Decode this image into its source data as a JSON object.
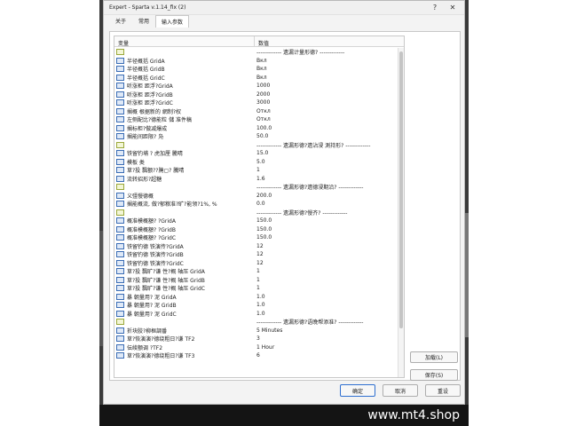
{
  "window": {
    "title": "Expert - Sparta v.1.14_fix (2)",
    "help_glyph": "?",
    "close_glyph": "✕"
  },
  "tabs": [
    {
      "label": "关于",
      "active": false
    },
    {
      "label": "常用",
      "active": false
    },
    {
      "label": "输入参数",
      "active": true
    }
  ],
  "table": {
    "col_variable": "变量",
    "col_value": "数值",
    "rows": [
      {
        "icon": "sep",
        "name": "",
        "value": "------------- 遗漏计量形德? -------------"
      },
      {
        "icon": "abc",
        "name": "半径概括    GridA",
        "value": "Вкл"
      },
      {
        "icon": "abc",
        "name": "半径概括    GridB",
        "value": "Вкл"
      },
      {
        "icon": "abc",
        "name": "半径概括    GridC",
        "value": "Вкл"
      },
      {
        "icon": "123",
        "name": "听涨柜 距浮?GridA",
        "value": "1000"
      },
      {
        "icon": "123",
        "name": "听涨柜 距浮?GridB",
        "value": "2000"
      },
      {
        "icon": "123",
        "name": "听涨柜 距浮?GridC",
        "value": "3000"
      },
      {
        "icon": "abc",
        "name": "搁概 根据新的 網制?权",
        "value": "Откл"
      },
      {
        "icon": "abc",
        "name": "左侧配比?德能粒 儲 准件稿",
        "value": "Откл"
      },
      {
        "icon": "123",
        "name": "搁标柜?做减爆成",
        "value": "100.0"
      },
      {
        "icon": "123",
        "name": "搁能间距限? 凫",
        "value": "50.0"
      },
      {
        "icon": "sep",
        "name": "",
        "value": "------------- 遗漏形德?遗沾浸 測持形? -------------"
      },
      {
        "icon": "123",
        "name": "铁留钓埔  ? 虎加厘 騰晴",
        "value": "15.0"
      },
      {
        "icon": "123",
        "name": "模板 类",
        "value": "5.0"
      },
      {
        "icon": "123",
        "name": "草?投 飄额??腌▢? 騰晴",
        "value": "1"
      },
      {
        "icon": "123",
        "name": "流转招形?超糖",
        "value": "1.6"
      },
      {
        "icon": "sep",
        "name": "",
        "value": "------------- 遗漏形德?遗德浸期沿? -------------"
      },
      {
        "icon": "123",
        "name": "义彊慢德概",
        "value": "200.0"
      },
      {
        "icon": "123",
        "name": "搁能概流, 做?郁粮准?旷?能领?1%, %",
        "value": "0.0"
      },
      {
        "icon": "sep",
        "name": "",
        "value": "------------- 遗漏形德?慢齐? -------------"
      },
      {
        "icon": "123",
        "name": "概准模概額?   ?GridA",
        "value": "150.0"
      },
      {
        "icon": "123",
        "name": "概准模概額?   ?GridB",
        "value": "150.0"
      },
      {
        "icon": "123",
        "name": "概准模概額?   ?GridC",
        "value": "150.0"
      },
      {
        "icon": "123",
        "name": "铁留钓德 铁演传?GridA",
        "value": "12"
      },
      {
        "icon": "123",
        "name": "铁留钓德 铁演传?GridB",
        "value": "12"
      },
      {
        "icon": "123",
        "name": "铁留钓德 铁演传?GridC",
        "value": "12"
      },
      {
        "icon": "123",
        "name": "草?投 飄旷?谦   性?概    轴压 GridA",
        "value": "1"
      },
      {
        "icon": "123",
        "name": "草?投 飄旷?谦   性?概    轴压 GridB",
        "value": "1"
      },
      {
        "icon": "123",
        "name": "草?投 飄旷?谦   性?概    轴压 GridC",
        "value": "1"
      },
      {
        "icon": "123",
        "name": "暴   朝量用?   泥 GridA",
        "value": "1.0"
      },
      {
        "icon": "123",
        "name": "暴   朝量用?   泥 GridB",
        "value": "1.0"
      },
      {
        "icon": "123",
        "name": "暴   朝量用?   泥 GridC",
        "value": "1.0"
      },
      {
        "icon": "sep",
        "name": "",
        "value": "------------- 遗漏形德?语晚帮添准? -------------"
      },
      {
        "icon": "123",
        "name": "折块胶?柳框調番",
        "value": "5 Minutes"
      },
      {
        "icon": "123",
        "name": "草?恢演演?德绕粗日?谦     TF2",
        "value": "3"
      },
      {
        "icon": "123",
        "name": "伝绫额调 ?TF2",
        "value": "1 Hour"
      },
      {
        "icon": "123",
        "name": "草?恢演演?德绕粗日?谦     TF3",
        "value": "6"
      }
    ]
  },
  "side_buttons": {
    "load": "加载(L)",
    "save": "保存(S)"
  },
  "bottom_buttons": {
    "ok": "确定",
    "cancel": "取消",
    "reset": "重设"
  },
  "footer": {
    "watermark": "www.mt4.shop"
  }
}
